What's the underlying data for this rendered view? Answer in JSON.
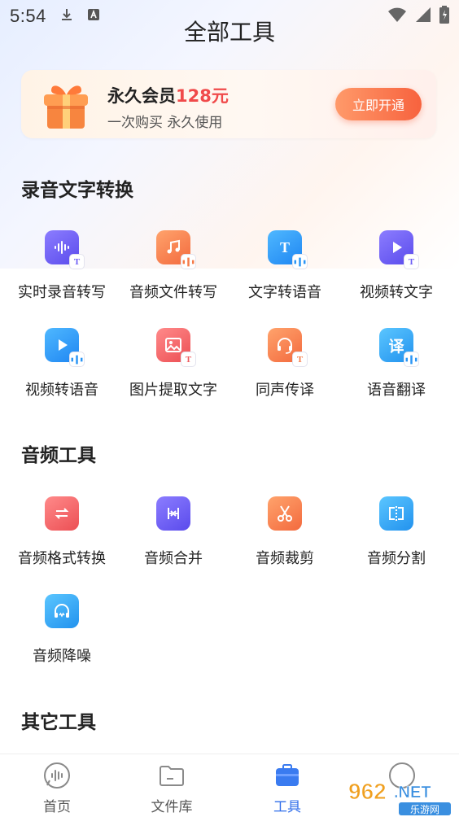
{
  "status_bar": {
    "time": "5:54"
  },
  "header": {
    "title": "全部工具"
  },
  "banner": {
    "title_prefix": "永久会员",
    "price": "128元",
    "subtitle": "一次购买 永久使用",
    "button_label": "立即开通"
  },
  "sections": [
    {
      "title": "录音文字转换",
      "tools": [
        {
          "label": "实时录音转写",
          "icon": "waveform-icon",
          "color": "#6b5cf5"
        },
        {
          "label": "音频文件转写",
          "icon": "music-note-icon",
          "color": "#f57a48"
        },
        {
          "label": "文字转语音",
          "icon": "text-t-icon",
          "color": "#2a95f5"
        },
        {
          "label": "视频转文字",
          "icon": "play-icon",
          "color": "#6b5cf5"
        },
        {
          "label": "视频转语音",
          "icon": "play-icon",
          "color": "#2a95f5"
        },
        {
          "label": "图片提取文字",
          "icon": "image-icon",
          "color": "#ee5a5f"
        },
        {
          "label": "同声传译",
          "icon": "headset-icon",
          "color": "#f57a48"
        },
        {
          "label": "语音翻译",
          "icon": "translate-icon",
          "color": "#2a95f5"
        }
      ]
    },
    {
      "title": "音频工具",
      "tools": [
        {
          "label": "音频格式转换",
          "icon": "convert-arrows-icon",
          "color": "#ee5a5f"
        },
        {
          "label": "音频合并",
          "icon": "merge-icon",
          "color": "#6b5cf5"
        },
        {
          "label": "音频裁剪",
          "icon": "scissors-icon",
          "color": "#f57a48"
        },
        {
          "label": "音频分割",
          "icon": "split-icon",
          "color": "#2a95f5"
        },
        {
          "label": "音频降噪",
          "icon": "headphones-icon",
          "color": "#2a95f5"
        }
      ]
    },
    {
      "title": "其它工具",
      "tools": []
    }
  ],
  "bottom_nav": [
    {
      "label": "首页",
      "icon": "home-waveform-icon",
      "active": false
    },
    {
      "label": "文件库",
      "icon": "folder-icon",
      "active": false
    },
    {
      "label": "工具",
      "icon": "toolbox-icon",
      "active": true
    },
    {
      "label": "",
      "icon": "profile-icon",
      "active": false
    }
  ],
  "watermark": {
    "text": "962.NET",
    "sub": "乐游网"
  },
  "colors": {
    "accent": "#2f6dea",
    "price": "#f04a4a",
    "button": "#f7623e"
  }
}
